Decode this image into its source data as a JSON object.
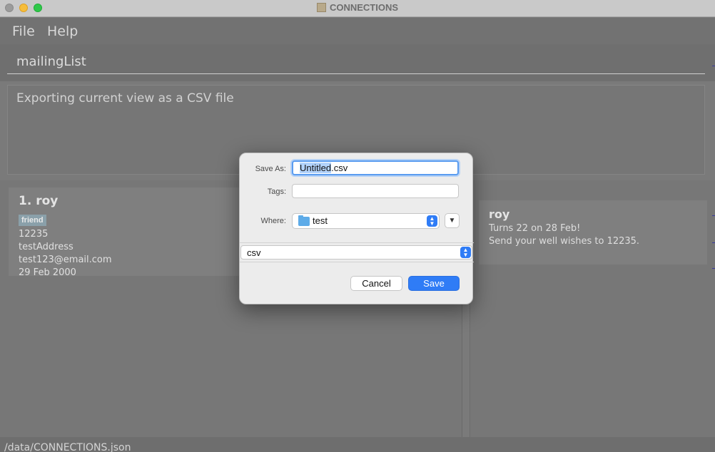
{
  "window": {
    "title": "CONNECTIONS"
  },
  "menu": {
    "file": "File",
    "help": "Help"
  },
  "command": {
    "value": "mailingList"
  },
  "result": {
    "text": "Exporting current view as a CSV file"
  },
  "person": {
    "name": "1.  roy",
    "tag": "friend",
    "phone": "12235",
    "address": "testAddress",
    "email": "test123@email.com",
    "birthday": "29 Feb 2000"
  },
  "birthday_reminder": {
    "name": "roy",
    "line1": "Turns 22 on 28 Feb!",
    "line2": "Send your well wishes to 12235."
  },
  "status": {
    "path": "/data/CONNECTIONS.json"
  },
  "dialog": {
    "save_as_label": "Save As:",
    "filename_selected": "Untitled",
    "filename_ext": ".csv",
    "tags_label": "Tags:",
    "where_label": "Where:",
    "where_value": "test",
    "format_value": "csv",
    "cancel_label": "Cancel",
    "save_label": "Save"
  },
  "colors": {
    "accent": "#2f7cf6"
  }
}
